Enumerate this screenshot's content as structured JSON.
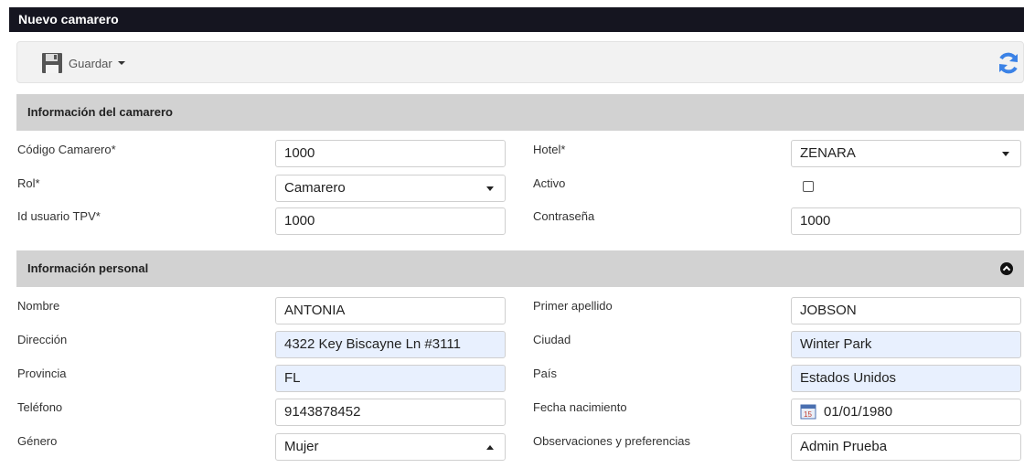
{
  "window": {
    "title": "Nuevo camarero"
  },
  "toolbar": {
    "save_label": "Guardar",
    "save_icon": "floppy-disk-icon",
    "refresh_icon": "refresh-icon"
  },
  "sections": {
    "info_camarero": "Información del camarero",
    "info_personal": "Información personal"
  },
  "camarero": {
    "codigo": {
      "label": "Código Camarero*",
      "value": "1000"
    },
    "hotel": {
      "label": "Hotel*",
      "value": "ZENARA"
    },
    "rol": {
      "label": "Rol*",
      "value": "Camarero"
    },
    "activo": {
      "label": "Activo",
      "checked": false
    },
    "id_tpv": {
      "label": "Id usuario TPV*",
      "value": "1000"
    },
    "contrasena": {
      "label": "Contraseña",
      "value": "1000"
    }
  },
  "personal": {
    "nombre": {
      "label": "Nombre",
      "value": "ANTONIA"
    },
    "apellido": {
      "label": "Primer apellido",
      "value": "JOBSON"
    },
    "direccion": {
      "label": "Dirección",
      "value": "4322 Key Biscayne Ln #3111"
    },
    "ciudad": {
      "label": "Ciudad",
      "value": "Winter Park"
    },
    "provincia": {
      "label": "Provincia",
      "value": "FL"
    },
    "pais": {
      "label": "País",
      "value": "Estados Unidos"
    },
    "telefono": {
      "label": "Teléfono",
      "value": "9143878452"
    },
    "fecha_nac": {
      "label": "Fecha nacimiento",
      "value": "01/01/1980",
      "icon": "calendar-icon"
    },
    "genero": {
      "label": "Género",
      "value": "Mujer"
    },
    "observaciones": {
      "label": "Observaciones y preferencias",
      "value": "Admin Prueba"
    }
  },
  "colors": {
    "title_bar": "#151520",
    "section_bg": "#d2d2d2",
    "autofill_bg": "#e8f0fe",
    "accent": "#3b82e6"
  }
}
